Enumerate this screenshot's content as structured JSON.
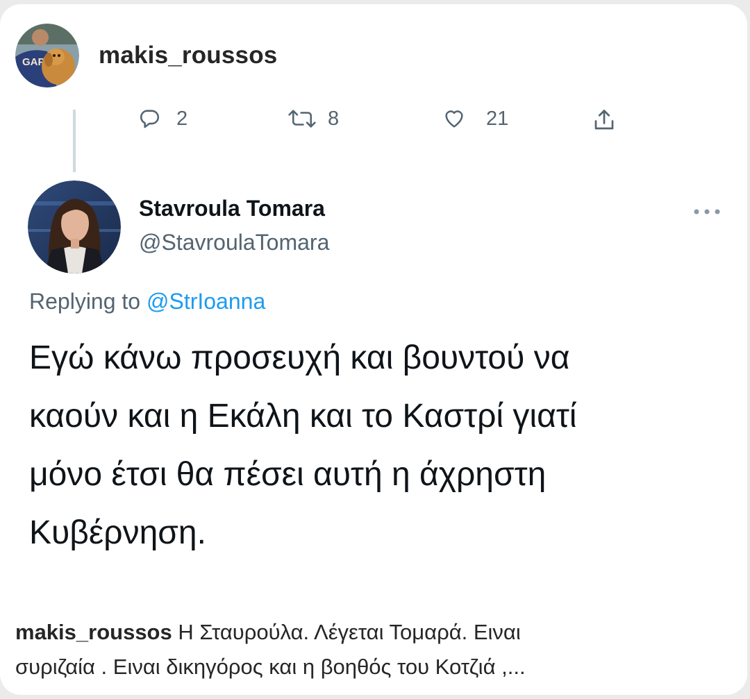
{
  "instagram": {
    "username": "makis_roussos"
  },
  "previous_tweet": {
    "reply_count": "2",
    "retweet_count": "8",
    "like_count": "21"
  },
  "tweet": {
    "display_name": "Stavroula Tomara",
    "handle": "@StavroulaTomara",
    "replying_prefix": "Replying to ",
    "replying_to": "@StrIoanna",
    "text_lines": [
      "Εγώ κάνω προσευχή και βουντού να",
      "καούν και η Εκάλη και το Καστρί γιατί",
      "μόνο έτσι θα πέσει αυτή η άχρηστη",
      "Κυβέρνηση."
    ]
  },
  "caption": {
    "username": "makis_roussos",
    "line1_text": " Η Σταυρούλα. Λέγεται Τομαρά. Ειναι",
    "line2_text": "συριζαία . Ειναι δικηγόρος και η βοηθός του Κοτζιά ,..."
  },
  "colors": {
    "text_primary": "#0f1419",
    "text_secondary": "#536471",
    "mention_blue": "#1d9bf0",
    "ig_text": "#262626"
  },
  "icons": [
    "reply-icon",
    "retweet-icon",
    "like-icon",
    "share-icon",
    "more-icon"
  ]
}
